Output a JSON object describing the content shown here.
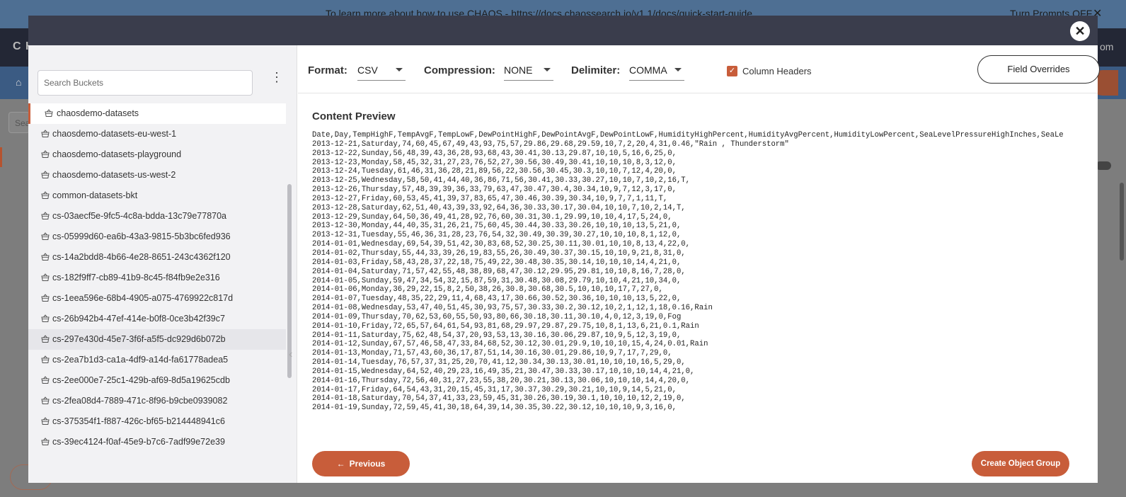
{
  "background": {
    "banner_message": "To learn more about how to use CHAOS - https://docs.chaossearch.io/v1.1/docs/quick-start-guide",
    "banner_toggle": "Turn Prompts OFF",
    "banner_close": "✕",
    "logo": "C H",
    "header_right": "om",
    "search_placeholder": "Sea"
  },
  "modal": {
    "close_glyph": "✕",
    "sidebar": {
      "search_placeholder": "Search Buckets",
      "menu_glyph": "⋮",
      "buckets": [
        "chaosdemo-datasets",
        "chaosdemo-datasets-eu-west-1",
        "chaosdemo-datasets-playground",
        "chaosdemo-datasets-us-west-2",
        "common-datasets-bkt",
        "cs-03aecf5e-9fc5-4c8a-bdda-13c79e77870a",
        "cs-05999d60-ea6b-43a3-9815-5b3bc6fed936",
        "cs-14a2bdd8-4b66-4e28-8651-243c4362f120",
        "cs-182f9ff7-cb89-41b9-8c45-f84fb9e2e316",
        "cs-1eea596e-68b4-4905-a075-4769922c817d",
        "cs-26b942b4-47ef-414e-b0f8-0ce3b42f39c7",
        "cs-297e430d-45e7-3f6f-a5f5-dc929d6b072b",
        "cs-2ea7b1d3-ca1a-4df9-a14d-fa61778adea5",
        "cs-2ee000e7-25c1-429b-af69-8d5a19625cdb",
        "cs-2fea08d4-7889-471c-8f96-b9cbe0939082",
        "cs-375354f1-f887-426c-bf65-b214448941c6",
        "cs-39ec4124-f0af-45e9-b7c6-7adf99e72e39"
      ],
      "collapse_glyph": "‹"
    },
    "toolbar": {
      "format_label": "Format:",
      "format_value": "CSV",
      "compression_label": "Compression:",
      "compression_value": "NONE",
      "delimiter_label": "Delimiter:",
      "delimiter_value": "COMMA",
      "column_headers_label": "Column Headers",
      "column_headers_checked": true,
      "field_overrides_label": "Field Overrides"
    },
    "content_preview_title": "Content Preview",
    "preview_lines": [
      "Date,Day,TempHighF,TempAvgF,TempLowF,DewPointHighF,DewPointAvgF,DewPointLowF,HumidityHighPercent,HumidityAvgPercent,HumidityLowPercent,SeaLevelPressureHighInches,SeaLe",
      "2013-12-21,Saturday,74,60,45,67,49,43,93,75,57,29.86,29.68,29.59,10,7,2,20,4,31,0.46,\"Rain , Thunderstorm\"",
      "2013-12-22,Sunday,56,48,39,43,36,28,93,68,43,30.41,30.13,29.87,10,10,5,16,6,25,0,",
      "2013-12-23,Monday,58,45,32,31,27,23,76,52,27,30.56,30.49,30.41,10,10,10,8,3,12,0,",
      "2013-12-24,Tuesday,61,46,31,36,28,21,89,56,22,30.56,30.45,30.3,10,10,7,12,4,20,0,",
      "2013-12-25,Wednesday,58,50,41,44,40,36,86,71,56,30.41,30.33,30.27,10,10,7,10,2,16,T,",
      "2013-12-26,Thursday,57,48,39,39,36,33,79,63,47,30.47,30.4,30.34,10,9,7,12,3,17,0,",
      "2013-12-27,Friday,60,53,45,41,39,37,83,65,47,30.46,30.39,30.34,10,9,7,7,1,11,T,",
      "2013-12-28,Saturday,62,51,40,43,39,33,92,64,36,30.33,30.17,30.04,10,10,7,10,2,14,T,",
      "2013-12-29,Sunday,64,50,36,49,41,28,92,76,60,30.31,30.1,29.99,10,10,4,17,5,24,0,",
      "2013-12-30,Monday,44,40,35,31,26,21,75,60,45,30.44,30.33,30.26,10,10,10,13,5,21,0,",
      "2013-12-31,Tuesday,55,46,36,31,28,23,76,54,32,30.49,30.39,30.27,10,10,10,8,1,12,0,",
      "2014-01-01,Wednesday,69,54,39,51,42,30,83,68,52,30.25,30.11,30.01,10,10,8,13,4,22,0,",
      "2014-01-02,Thursday,55,44,33,39,26,19,83,55,26,30.49,30.37,30.15,10,10,9,21,8,31,0,",
      "2014-01-03,Friday,58,43,28,37,22,18,75,49,22,30.48,30.35,30.14,10,10,10,14,4,21,0,",
      "2014-01-04,Saturday,71,57,42,55,48,38,89,68,47,30.12,29.95,29.81,10,10,8,16,7,28,0,",
      "2014-01-05,Sunday,59,47,34,54,32,15,87,59,31,30.48,30.08,29.79,10,10,4,21,10,34,0,",
      "2014-01-06,Monday,36,29,22,15,8,2,50,38,26,30.8,30.68,30.5,10,10,10,17,7,27,0,",
      "2014-01-07,Tuesday,48,35,22,29,11,4,68,43,17,30.66,30.52,30.36,10,10,10,13,5,22,0,",
      "2014-01-08,Wednesday,53,47,40,51,45,30,93,75,57,30.33,30.2,30.12,10,2,1,12,1,18,0.16,Rain",
      "2014-01-09,Thursday,70,62,53,60,55,50,93,80,66,30.18,30.11,30.10,4,0,12,3,19,0,Fog",
      "2014-01-10,Friday,72,65,57,64,61,54,93,81,68,29.97,29.87,29.75,10,8,1,13,6,21,0.1,Rain",
      "2014-01-11,Saturday,75,62,48,54,37,20,93,53,13,30.16,30.06,29.87,10,9,5,12,3,19,0,",
      "2014-01-12,Sunday,67,57,46,58,47,33,84,68,52,30.12,30.01,29.9,10,10,10,15,4,24,0.01,Rain",
      "2014-01-13,Monday,71,57,43,60,36,17,87,51,14,30.16,30.01,29.86,10,9,7,17,7,29,0,",
      "2014-01-14,Tuesday,76,57,37,31,25,20,70,41,12,30.34,30.13,30.01,10,10,10,16,5,29,0,",
      "2014-01-15,Wednesday,64,52,40,29,23,16,49,35,21,30.47,30.33,30.17,10,10,10,14,4,21,0,",
      "2014-01-16,Thursday,72,56,40,31,27,23,55,38,20,30.21,30.13,30.06,10,10,10,14,4,20,0,",
      "2014-01-17,Friday,64,54,43,31,20,15,45,31,17,30.37,30.29,30.21,10,10,9,14,5,21,0,",
      "2014-01-18,Saturday,70,54,37,41,33,23,59,45,31,30.26,30.19,30.1,10,10,10,12,2,19,0,",
      "2014-01-19,Sunday,72,59,45,41,30,18,64,39,14,30.35,30.22,30.12,10,10,10,9,3,16,0,"
    ],
    "previous_label": "Previous",
    "previous_arrow": "←",
    "create_label": "Create Object Group",
    "accent_color": "#c85d3a"
  }
}
